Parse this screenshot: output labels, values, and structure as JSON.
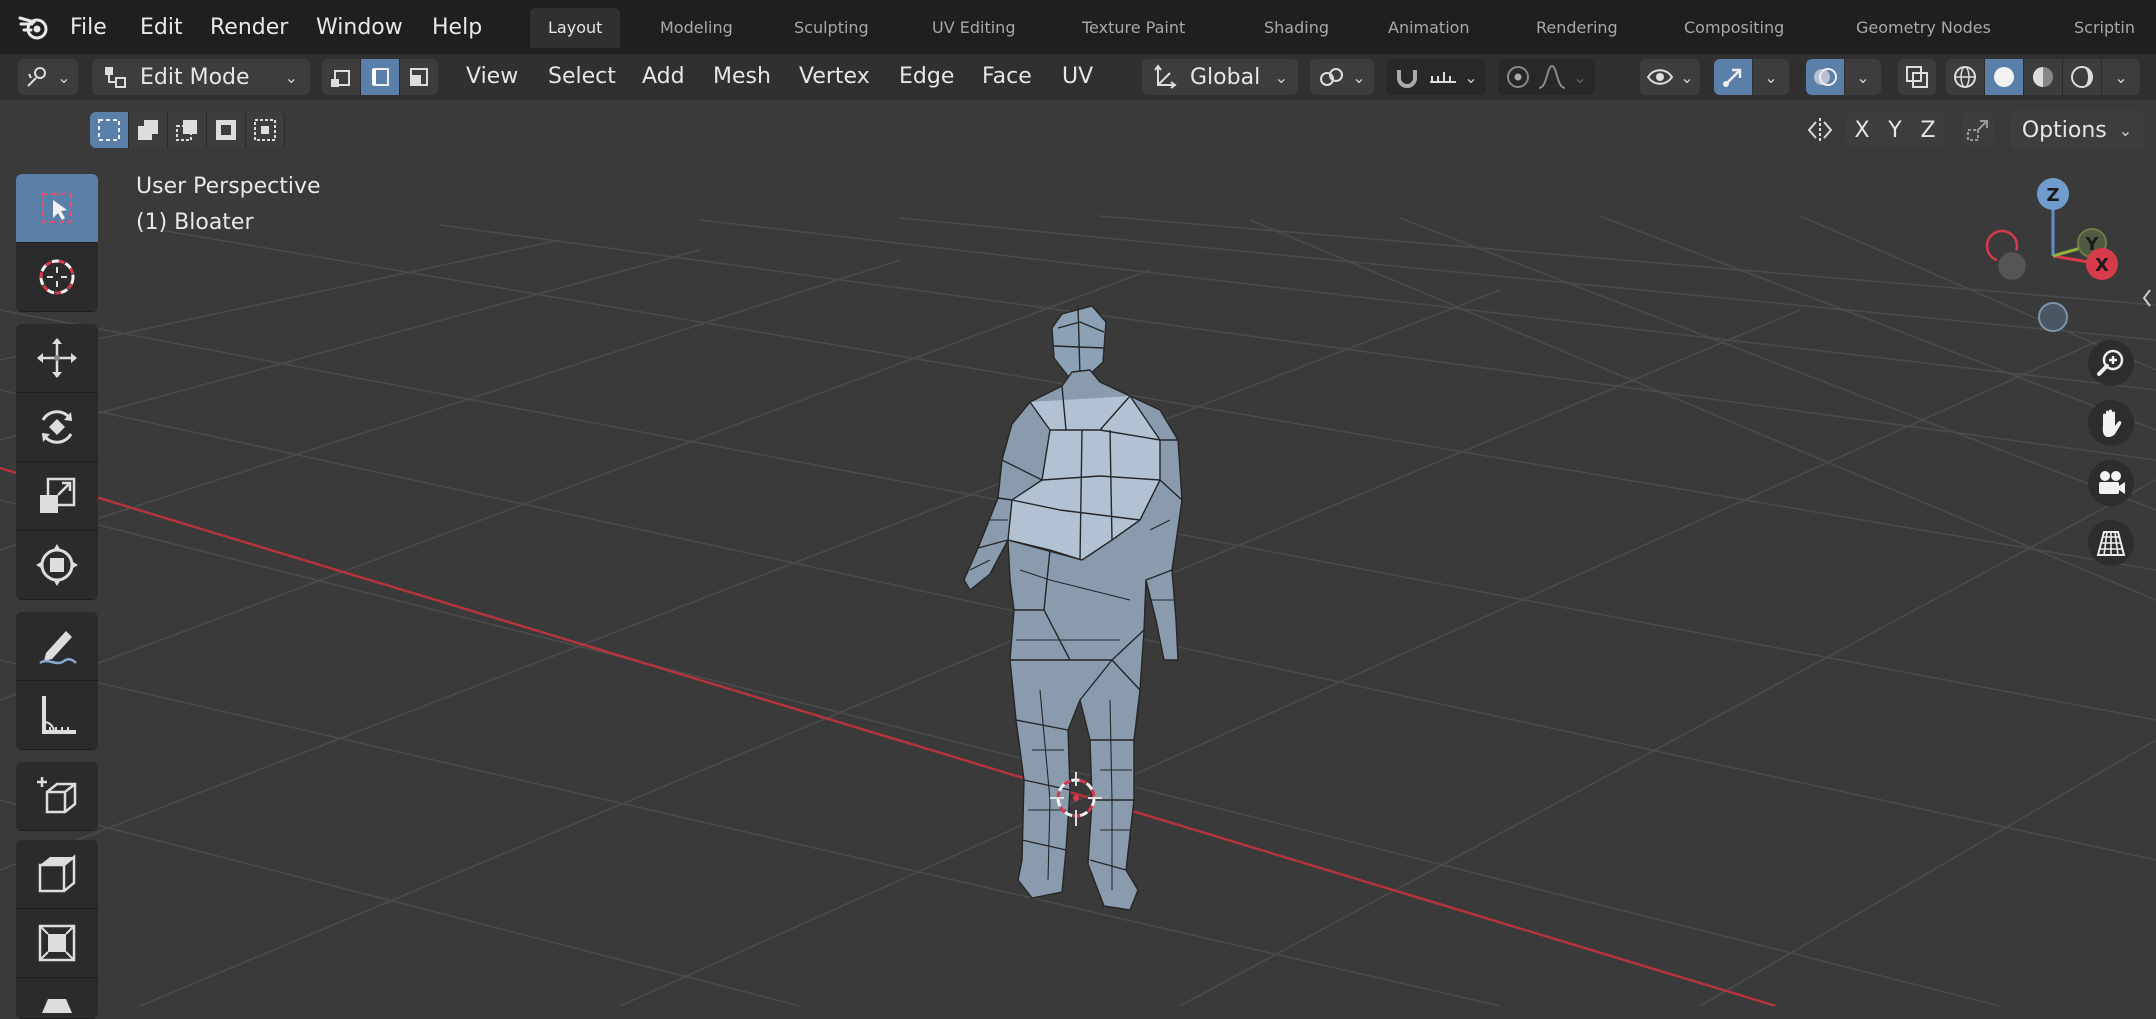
{
  "menu": {
    "items": [
      "File",
      "Edit",
      "Render",
      "Window",
      "Help"
    ]
  },
  "workspace_tabs": [
    {
      "label": "Layout",
      "active": true
    },
    {
      "label": "Modeling",
      "active": false
    },
    {
      "label": "Sculpting",
      "active": false
    },
    {
      "label": "UV Editing",
      "active": false
    },
    {
      "label": "Texture Paint",
      "active": false
    },
    {
      "label": "Shading",
      "active": false
    },
    {
      "label": "Animation",
      "active": false
    },
    {
      "label": "Rendering",
      "active": false
    },
    {
      "label": "Compositing",
      "active": false
    },
    {
      "label": "Geometry Nodes",
      "active": false
    },
    {
      "label": "Scriptin",
      "active": false
    }
  ],
  "header": {
    "mode": "Edit Mode",
    "menus": [
      "View",
      "Select",
      "Add",
      "Mesh",
      "Vertex",
      "Edge",
      "Face",
      "UV"
    ],
    "transform_orientation": "Global"
  },
  "subheader": {
    "axes": [
      "X",
      "Y",
      "Z"
    ],
    "options_label": "Options"
  },
  "viewport": {
    "view_name": "User Perspective",
    "object_label": "(1) Bloater"
  },
  "gizmo": {
    "z": "Z",
    "y": "Y",
    "x": "X",
    "colors": {
      "x": "#d63a4b",
      "y": "#8fb33b",
      "z": "#5e8fc7"
    }
  },
  "colors": {
    "accent": "#5a7fa8",
    "x_axis_line": "#b8343d",
    "background": "#3a3a3a"
  }
}
